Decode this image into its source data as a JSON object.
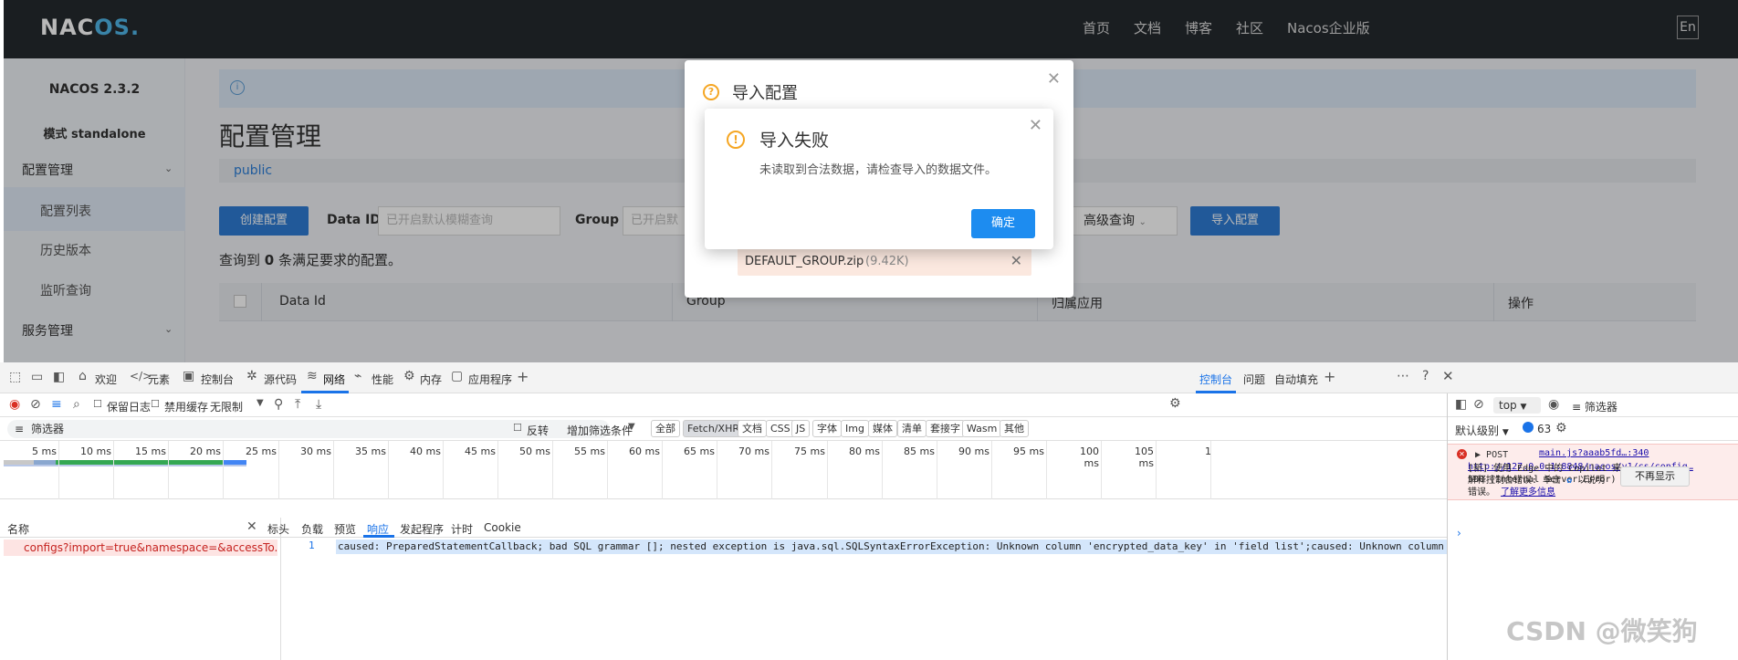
{
  "nacos": {
    "logo_main": "NAC",
    "logo_accent": "OS.",
    "nav": [
      "首页",
      "文档",
      "博客",
      "社区",
      "Nacos企业版"
    ],
    "lang": "En",
    "version": "NACOS 2.3.2",
    "mode": "模式 standalone",
    "menu_config": "配置管理",
    "sub_list": "配置列表",
    "sub_history": "历史版本",
    "sub_listen": "监听查询",
    "menu_service": "服务管理",
    "page_title": "配置管理",
    "namespace": "public",
    "create_btn": "创建配置",
    "dataid_label": "Data ID",
    "dataid_placeholder": "已开启默认模糊查询",
    "group_label": "Group",
    "group_placeholder": "已开启默",
    "adv_query": "高级查询",
    "import_btn": "导入配置",
    "result_prefix": "查询到",
    "result_count": "0",
    "result_suffix": "条满足要求的配置。",
    "col_dataid": "Data Id",
    "col_group": "Group",
    "col_app": "归属应用",
    "col_ops": "操作"
  },
  "import_dialog": {
    "title": "导入配置",
    "file_name": "DEFAULT_GROUP.zip",
    "file_size": "(9.42K)"
  },
  "fail_dialog": {
    "title": "导入失败",
    "message": "未读取到合法数据，请检查导入的数据文件。",
    "ok": "确定"
  },
  "devtools": {
    "tabs": [
      "欢迎",
      "元素",
      "控制台",
      "源代码",
      "网络",
      "性能",
      "内存",
      "应用程序"
    ],
    "active_tab": "网络",
    "preserve_log": "保留日志",
    "disable_cache": "禁用缓存",
    "throttle": "无限制",
    "filter_placeholder": "筛选器",
    "invert": "反转",
    "more_filters": "增加筛选条件",
    "filter_types": [
      "全部",
      "Fetch/XHR",
      "文档",
      "CSS",
      "JS",
      "字体",
      "Img",
      "媒体",
      "清单",
      "套接字",
      "Wasm",
      "其他"
    ],
    "active_filter": "Fetch/XHR",
    "ticks": [
      "5 ms",
      "10 ms",
      "15 ms",
      "20 ms",
      "25 ms",
      "30 ms",
      "35 ms",
      "40 ms",
      "45 ms",
      "50 ms",
      "55 ms",
      "60 ms",
      "65 ms",
      "70 ms",
      "75 ms",
      "80 ms",
      "85 ms",
      "90 ms",
      "95 ms",
      "100 ms",
      "105 ms",
      "1"
    ],
    "name_header": "名称",
    "request_name": "configs?import=true&namespace=&accessTo...",
    "detail_tabs": [
      "标头",
      "负载",
      "预览",
      "响应",
      "发起程序",
      "计时",
      "Cookie"
    ],
    "active_detail": "响应",
    "line_number": "1",
    "response_text": "caused: PreparedStatementCallback; bad SQL grammar []; nested exception is java.sql.SQLSyntaxErrorException: Unknown column 'encrypted_data_key' in 'field list';caused: Unknown column"
  },
  "console": {
    "tabs": [
      "控制台",
      "问题",
      "自动填充"
    ],
    "context": "top",
    "filter": "筛选器",
    "level": "默认级别",
    "count": "63",
    "method": "POST",
    "source": "main.js?aaab5fd…:340",
    "url": "http://127.0.0.1:8848/nacos/v1/cs/config…",
    "status": "500 (Internal Server Error)",
    "copilot_line1": "[新] 使用 Edge 中的 Copilot 来",
    "copilot_line2": "解释控制台错误: 单击",
    "copilot_line3": "以说明",
    "copilot_line4": "错误。",
    "learn_more": "了解更多信息",
    "dismiss": "不再显示"
  },
  "watermark": "CSDN @微笑狗",
  "colors": {
    "nacos_blue": "#2f7cd4",
    "ok_blue": "#1d8cf0",
    "error_red": "#c5221f",
    "warn_orange": "#f5a623"
  }
}
